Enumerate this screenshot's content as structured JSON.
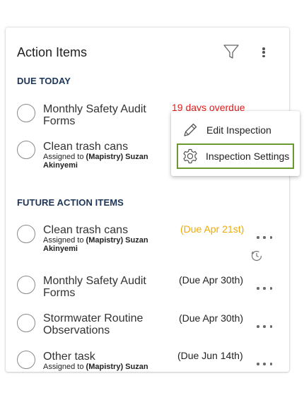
{
  "card": {
    "title": "Action Items",
    "filter_icon": "filter-icon",
    "more_icon": "more-vertical-icon"
  },
  "due_today": {
    "heading": "DUE TODAY",
    "tasks": [
      {
        "name_line1": "Monthly Safety Audit",
        "name_line2": "Forms",
        "due": "19 days overdue"
      },
      {
        "name": "Clean trash cans",
        "assigned_prefix": "Assigned to ",
        "assigned_name_line1": "(Mapistry) Suzan",
        "assigned_name_line2": "Akinyemi"
      }
    ]
  },
  "future": {
    "heading": "FUTURE ACTION ITEMS",
    "tasks": [
      {
        "name": "Clean trash cans",
        "assigned_prefix": "Assigned to ",
        "assigned_name_line1": "(Mapistry) Suzan",
        "assigned_name_line2": "Akinyemi",
        "due": "(Due Apr 21st)",
        "icon": "recurring-icon"
      },
      {
        "name_line1": "Monthly Safety Audit",
        "name_line2": "Forms",
        "due": "(Due Apr 30th)"
      },
      {
        "name_line1": "Stormwater Routine",
        "name_line2": "Observations",
        "due": "(Due Apr 30th)"
      },
      {
        "name": "Other task",
        "assigned_prefix": "Assigned to ",
        "assigned_name_line1": "(Mapistry) Suzan",
        "due": "(Due Jun 14th)"
      }
    ]
  },
  "menu": {
    "items": [
      {
        "label": "Edit Inspection",
        "icon": "pencil-icon"
      },
      {
        "label": "Inspection Settings",
        "icon": "gear-icon",
        "highlighted": true
      }
    ]
  },
  "colors": {
    "section_heading": "#1d3557",
    "overdue": "#e02020",
    "due_soon": "#f2a900",
    "highlight_border": "#6a9a2f"
  }
}
